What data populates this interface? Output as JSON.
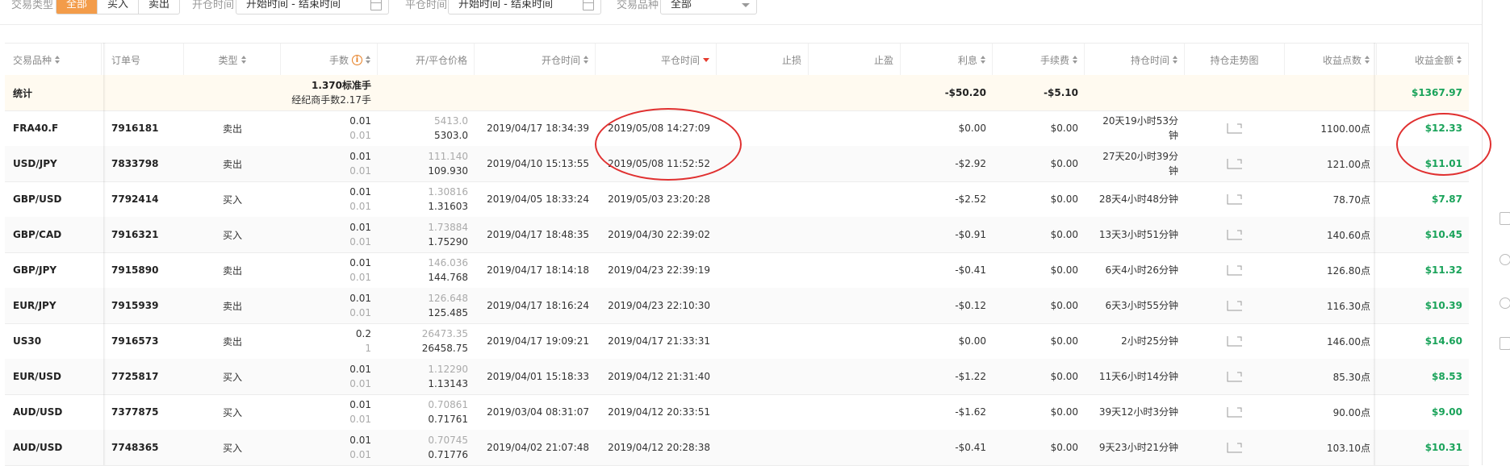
{
  "filters": {
    "trade_type_label": "交易类型",
    "trade_type_options": [
      "全部",
      "买入",
      "卖出"
    ],
    "open_time_label": "开仓时间",
    "open_time_value": "开始时间 - 结束时间",
    "close_time_label": "平仓时间",
    "close_time_value": "开始时间 - 结束时间",
    "product_label": "交易品种",
    "product_value": "全部"
  },
  "columns": {
    "product": "交易品种",
    "order": "订单号",
    "type": "类型",
    "lots": "手数",
    "price": "开/平仓价格",
    "open_time": "开仓时间",
    "close_time": "平仓时间",
    "stop_loss": "止损",
    "take_profit": "止盈",
    "interest": "利息",
    "fee": "手续费",
    "hold_time": "持仓时间",
    "trend": "持仓走势图",
    "points": "收益点数",
    "profit": "收益金额"
  },
  "stats": {
    "label": "统计",
    "lots_line1": "1.370标准手",
    "lots_line2": "经纪商手数2.17手",
    "interest": "-$50.20",
    "fee": "-$5.10",
    "profit": "$1367.97"
  },
  "rows": [
    {
      "product": "FRA40.F",
      "order": "7916181",
      "type": "卖出",
      "lots1": "0.01",
      "lots2": "0.01",
      "price_open": "5413.0",
      "price_close": "5303.0",
      "open_time": "2019/04/17 18:34:39",
      "close_time": "2019/05/08 14:27:09",
      "interest": "$0.00",
      "fee": "$0.00",
      "hold1": "20天19小时53分",
      "hold2": "钟",
      "points": "1100.00点",
      "profit": "$12.33"
    },
    {
      "product": "USD/JPY",
      "order": "7833798",
      "type": "卖出",
      "lots1": "0.01",
      "lots2": "0.01",
      "price_open": "111.140",
      "price_close": "109.930",
      "open_time": "2019/04/10 15:13:55",
      "close_time": "2019/05/08 11:52:52",
      "interest": "-$2.92",
      "fee": "$0.00",
      "hold1": "27天20小时39分",
      "hold2": "钟",
      "points": "121.00点",
      "profit": "$11.01"
    },
    {
      "product": "GBP/USD",
      "order": "7792414",
      "type": "买入",
      "lots1": "0.01",
      "lots2": "0.01",
      "price_open": "1.30816",
      "price_close": "1.31603",
      "open_time": "2019/04/05 18:33:24",
      "close_time": "2019/05/03 23:20:28",
      "interest": "-$2.52",
      "fee": "$0.00",
      "hold1": "28天4小时48分钟",
      "hold2": "",
      "points": "78.70点",
      "profit": "$7.87"
    },
    {
      "product": "GBP/CAD",
      "order": "7916321",
      "type": "买入",
      "lots1": "0.01",
      "lots2": "0.01",
      "price_open": "1.73884",
      "price_close": "1.75290",
      "open_time": "2019/04/17 18:48:35",
      "close_time": "2019/04/30 22:39:02",
      "interest": "-$0.91",
      "fee": "$0.00",
      "hold1": "13天3小时51分钟",
      "hold2": "",
      "points": "140.60点",
      "profit": "$10.45"
    },
    {
      "product": "GBP/JPY",
      "order": "7915890",
      "type": "卖出",
      "lots1": "0.01",
      "lots2": "0.01",
      "price_open": "146.036",
      "price_close": "144.768",
      "open_time": "2019/04/17 18:14:18",
      "close_time": "2019/04/23 22:39:19",
      "interest": "-$0.41",
      "fee": "$0.00",
      "hold1": "6天4小时26分钟",
      "hold2": "",
      "points": "126.80点",
      "profit": "$11.32"
    },
    {
      "product": "EUR/JPY",
      "order": "7915939",
      "type": "卖出",
      "lots1": "0.01",
      "lots2": "0.01",
      "price_open": "126.648",
      "price_close": "125.485",
      "open_time": "2019/04/17 18:16:24",
      "close_time": "2019/04/23 22:10:30",
      "interest": "-$0.12",
      "fee": "$0.00",
      "hold1": "6天3小时55分钟",
      "hold2": "",
      "points": "116.30点",
      "profit": "$10.39"
    },
    {
      "product": "US30",
      "order": "7916573",
      "type": "卖出",
      "lots1": "0.2",
      "lots2": "1",
      "price_open": "26473.35",
      "price_close": "26458.75",
      "open_time": "2019/04/17 19:09:21",
      "close_time": "2019/04/17 21:33:31",
      "interest": "$0.00",
      "fee": "$0.00",
      "hold1": "2小时25分钟",
      "hold2": "",
      "points": "146.00点",
      "profit": "$14.60"
    },
    {
      "product": "EUR/USD",
      "order": "7725817",
      "type": "买入",
      "lots1": "0.01",
      "lots2": "0.01",
      "price_open": "1.12290",
      "price_close": "1.13143",
      "open_time": "2019/04/01 15:18:33",
      "close_time": "2019/04/12 21:31:40",
      "interest": "-$1.22",
      "fee": "$0.00",
      "hold1": "11天6小时14分钟",
      "hold2": "",
      "points": "85.30点",
      "profit": "$8.53"
    },
    {
      "product": "AUD/USD",
      "order": "7377875",
      "type": "买入",
      "lots1": "0.01",
      "lots2": "0.01",
      "price_open": "0.70861",
      "price_close": "0.71761",
      "open_time": "2019/03/04 08:31:07",
      "close_time": "2019/04/12 20:33:51",
      "interest": "-$1.62",
      "fee": "$0.00",
      "hold1": "39天12小时3分钟",
      "hold2": "",
      "points": "90.00点",
      "profit": "$9.00"
    },
    {
      "product": "AUD/USD",
      "order": "7748365",
      "type": "买入",
      "lots1": "0.01",
      "lots2": "0.01",
      "price_open": "0.70745",
      "price_close": "0.71776",
      "open_time": "2019/04/02 21:07:48",
      "close_time": "2019/04/12 20:28:38",
      "interest": "-$0.41",
      "fee": "$0.00",
      "hold1": "9天23小时21分钟",
      "hold2": "",
      "points": "103.10点",
      "profit": "$10.31"
    }
  ],
  "colors": {
    "accent": "#f39c4a",
    "profit_green": "#1aa35a",
    "annotation_red": "#e03030",
    "sort_active": "#e63b2e"
  }
}
